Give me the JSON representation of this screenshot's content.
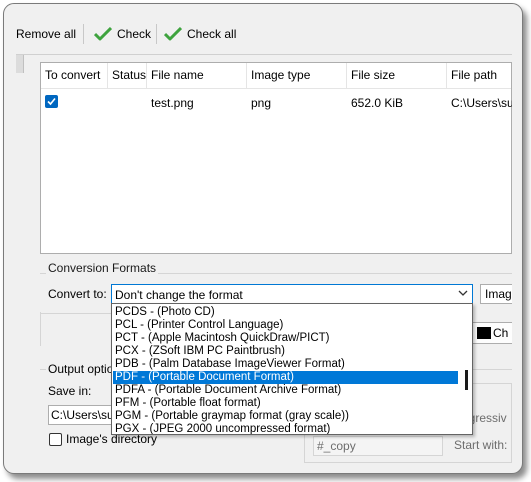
{
  "toolbar": {
    "remove_all_label": "Remove all",
    "check_label": "Check",
    "check_all_label": "Check all"
  },
  "table": {
    "columns": [
      "To convert",
      "Status",
      "File name",
      "Image type",
      "File size",
      "File path"
    ],
    "rows": [
      {
        "to_convert": true,
        "status": "",
        "file_name": "test.png",
        "image_type": "png",
        "file_size": "652.0 KiB",
        "file_path": "C:\\Users\\su"
      }
    ]
  },
  "conversion": {
    "group_title": "Conversion Formats",
    "convert_to_label": "Convert to:",
    "selected_format": "Don't change the format",
    "secondary_combo": "Image",
    "color_button": "Ch",
    "dropdown_options": [
      "PCDS - (Photo CD)",
      "PCL - (Printer Control Language)",
      "PCT - (Apple Macintosh QuickDraw/PICT)",
      "PCX - (ZSoft IBM PC Paintbrush)",
      "PDB - (Palm Database ImageViewer Format)",
      "PDF - (Portable Document Format)",
      "PDFA - (Portable Document Archive Format)",
      "PFM - (Portable float format)",
      "PGM - (Portable graymap format (gray scale))",
      "PGX - (JPEG 2000 uncompressed format)"
    ],
    "highlighted_option": "PDF - (Portable Document Format)"
  },
  "output": {
    "group_title": "Output option",
    "save_in_label": "Save in:",
    "save_in_value": "C:\\Users\\sul",
    "image_directory_label": "Image's directory",
    "image_directory_checked": false,
    "progressive_label": "ogressiv",
    "copy_suffix": "#_copy",
    "start_with_label": "Start with:"
  },
  "colors": {
    "accent": "#0078d7",
    "check_green": "#3ea33e",
    "window_bg": "#f0f0f0"
  }
}
